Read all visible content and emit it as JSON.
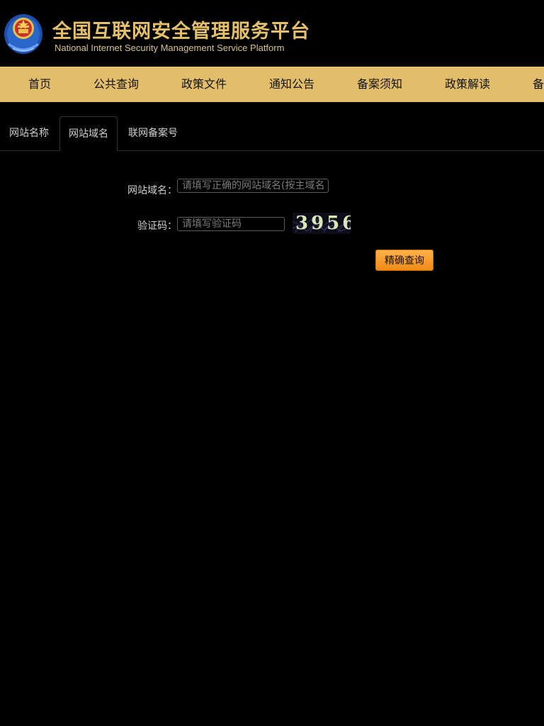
{
  "header": {
    "title": "全国互联网安全管理服务平台",
    "subtitle": "National Internet Security Management Service Platform",
    "emblem_icon": "police-emblem-icon"
  },
  "nav": {
    "items": [
      {
        "label": "首页"
      },
      {
        "label": "公共查询"
      },
      {
        "label": "政策文件"
      },
      {
        "label": "通知公告"
      },
      {
        "label": "备案须知"
      },
      {
        "label": "政策解读"
      },
      {
        "label": "备"
      }
    ]
  },
  "tabs": [
    {
      "label": "网站名称",
      "active": false
    },
    {
      "label": "网站域名",
      "active": true
    },
    {
      "label": "联网备案号",
      "active": false
    }
  ],
  "form": {
    "domain_label": "网站域名：",
    "domain_placeholder": "请填写正确的网站域名(按主域名",
    "domain_value": "",
    "captcha_label": "验证码：",
    "captcha_placeholder": "请填写验证码",
    "captcha_value": "",
    "captcha_image_text": "3956",
    "submit_label": "精确查询"
  },
  "colors": {
    "background": "#000000",
    "nav_bar": "#e2be6a",
    "brand_gold": "#e5c06a",
    "button_orange": "#f5a030"
  }
}
